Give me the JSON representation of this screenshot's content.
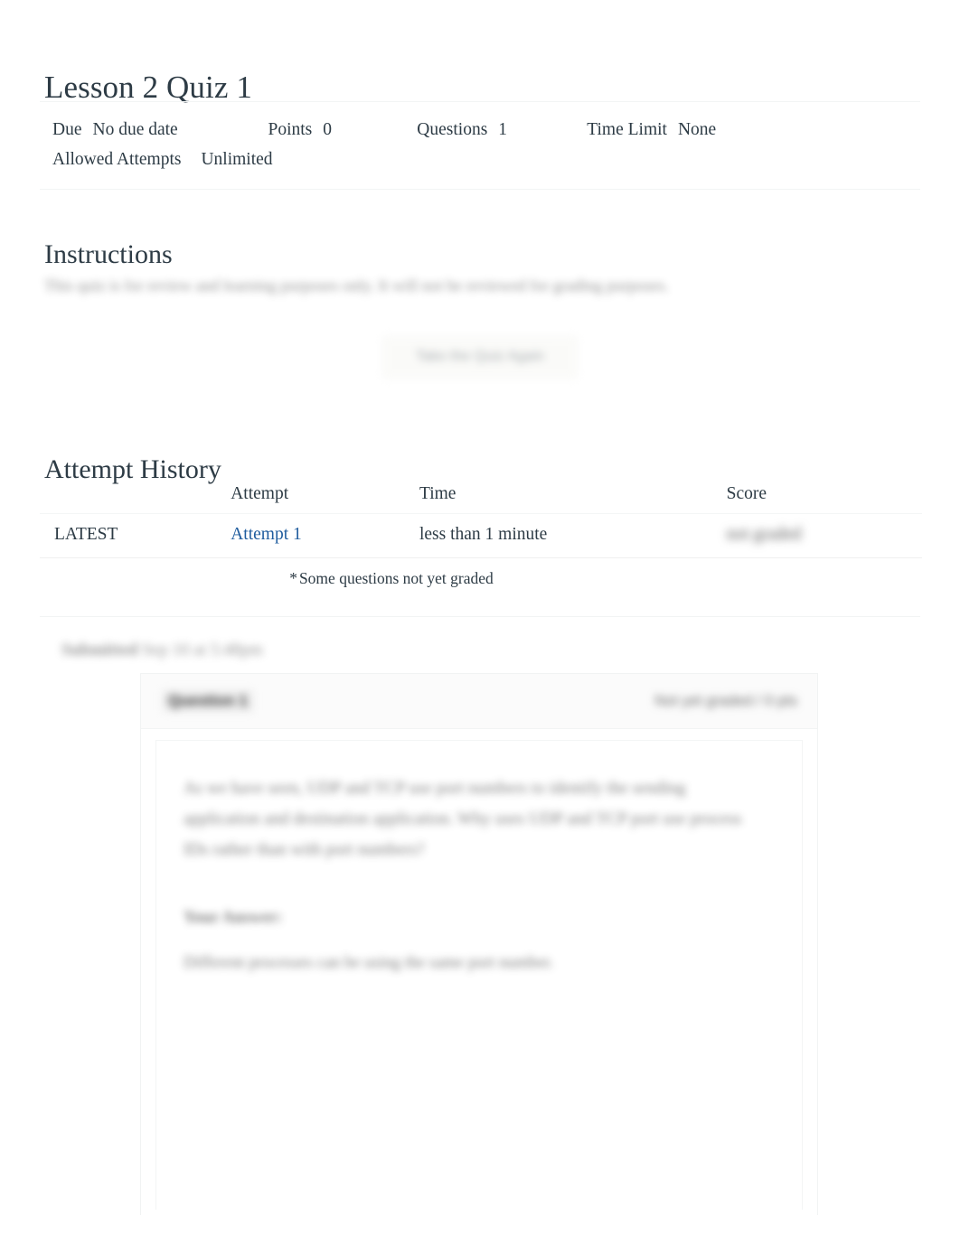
{
  "page": {
    "title": "Lesson 2 Quiz 1"
  },
  "meta": {
    "due_label": "Due",
    "due_value": "No due date",
    "points_label": "Points",
    "points_value": "0",
    "questions_label": "Questions",
    "questions_value": "1",
    "time_limit_label": "Time Limit",
    "time_limit_value": "None",
    "allowed_attempts_label": "Allowed Attempts",
    "allowed_attempts_value": "Unlimited"
  },
  "instructions": {
    "heading": "Instructions",
    "body": "This quiz is for review and learning purposes only. It will not be reviewed for grading purposes."
  },
  "take_quiz": {
    "label": "Take the Quiz Again"
  },
  "attempt_history": {
    "heading": "Attempt History",
    "columns": [
      "",
      "Attempt",
      "Time",
      "Score"
    ],
    "rows": [
      {
        "kept": "LATEST",
        "attempt": "Attempt 1",
        "time": "less than 1 minute",
        "score": "not graded"
      }
    ],
    "note_star": "*",
    "note_text": "Some questions not yet graded"
  },
  "submission": {
    "label": "Submitted",
    "value": "Sep 10 at 5:48pm"
  },
  "question": {
    "name": "Question 1",
    "status": "Not yet graded / 0 pts",
    "text": "As we have seen, UDP and TCP use port numbers to identify the sending application and destination application. Why uses UDP and TCP port use process IDs rather than with port numbers?",
    "answer_label": "Your Answer:",
    "answer_text": "Different processes can be using the same port number."
  },
  "colors": {
    "link": "#1f5c9e",
    "text": "#2d3b45",
    "divider": "#f2f4f4",
    "card_header_bg": "#fbfbfb"
  }
}
